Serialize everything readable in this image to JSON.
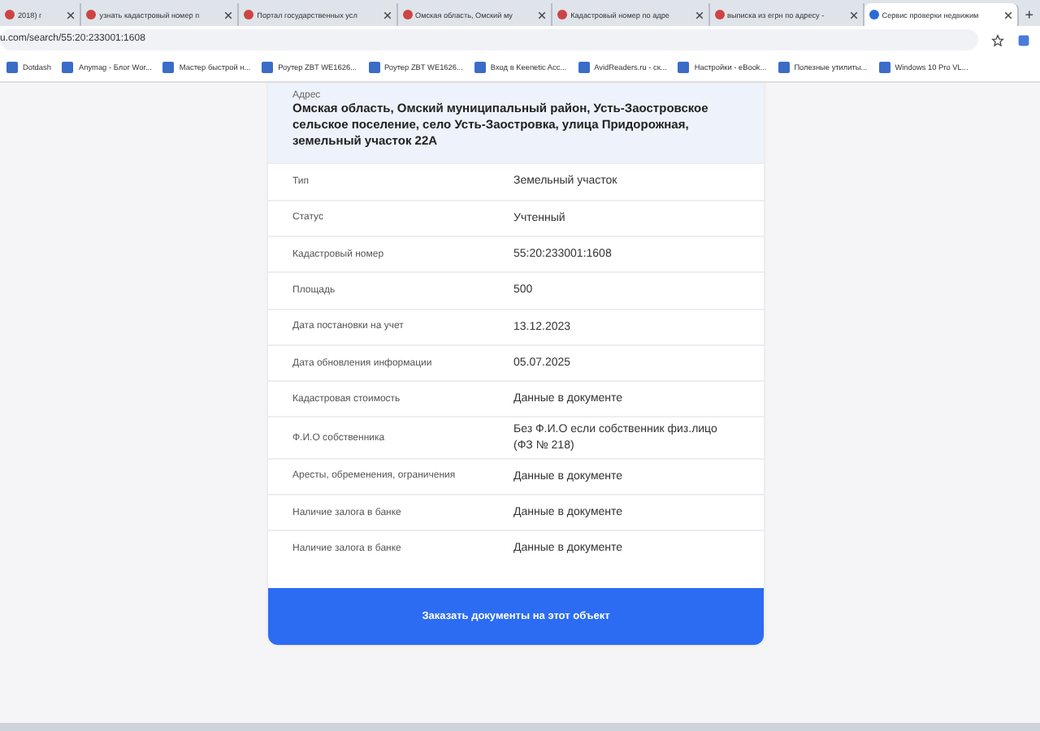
{
  "tabs": [
    {
      "title": "2018) г",
      "selected": false
    },
    {
      "title": "узнать кадастровый номер п",
      "selected": false
    },
    {
      "title": "Портал государственных усл",
      "selected": false
    },
    {
      "title": "Омская область, Омский му",
      "selected": false
    },
    {
      "title": "Кадастровый номер по адре",
      "selected": false
    },
    {
      "title": "выписка из егрн по адресу -",
      "selected": false
    },
    {
      "title": "Сервис проверки недвижим",
      "selected": true
    }
  ],
  "new_tab": "+",
  "address_bar": {
    "url": "u.com/search/55:20:233001:1608"
  },
  "bookmarks": [
    "Dotdash",
    "Anymag - Блог Wor...",
    "Мастер быстрой н...",
    "Роутер ZBT WE1626...",
    "Роутер ZBT WE1626...",
    "Вход в Keenetic Acc...",
    "AvidReaders.ru - ск...",
    "Настройки - eBook...",
    "Полезные утилиты...",
    "Windows 10 Pro VL..."
  ],
  "card": {
    "address_label": "Адрес",
    "address": "Омская область, Омский муниципальный район, Усть-Заостровское сельское поселение, село Усть-Заостровка, улица Придорожная, земельный участок 22А",
    "rows": [
      {
        "label": "Тип",
        "value": "Земельный участок"
      },
      {
        "label": "Статус",
        "value": "Учтенный"
      },
      {
        "label": "Кадастровый номер",
        "value": "55:20:233001:1608"
      },
      {
        "label": "Площадь",
        "value": "500"
      },
      {
        "label": "Дата постановки на учет",
        "value": "13.12.2023"
      },
      {
        "label": "Дата обновления информации",
        "value": "05.07.2025"
      },
      {
        "label": "Кадастровая стоимость",
        "value": "Данные в документе"
      },
      {
        "label": "Ф.И.О собственника",
        "value": "Без Ф.И.О если собственник физ.лицо (ФЗ № 218)"
      },
      {
        "label": "Аресты, обременения, ограничения",
        "value": "Данные в документе"
      },
      {
        "label": "Наличие залога в банке",
        "value": "Данные в документе"
      },
      {
        "label": "Наличие залога в банке",
        "value": "Данные в документе"
      }
    ],
    "button": "Заказать документы на этот объект"
  }
}
